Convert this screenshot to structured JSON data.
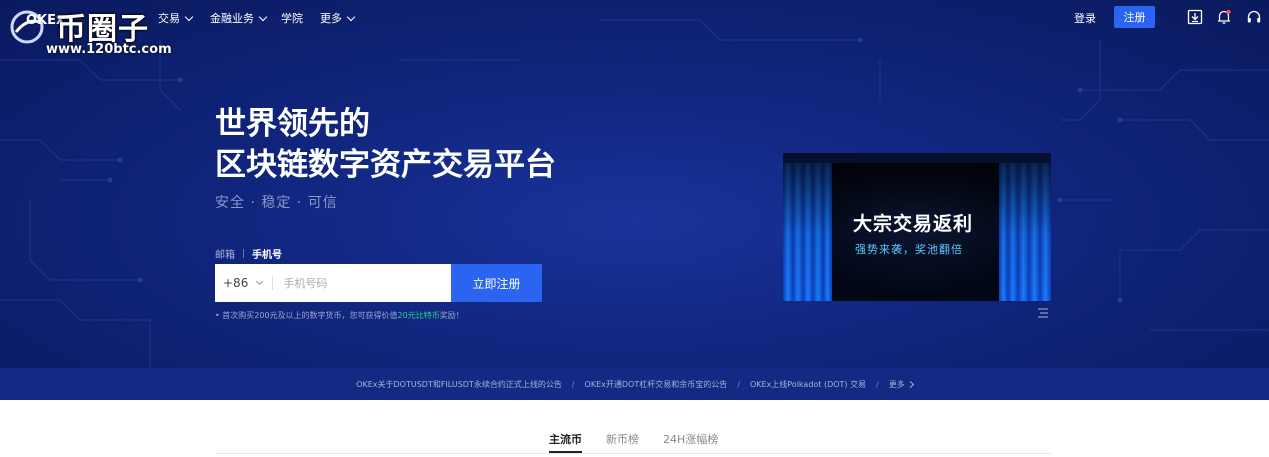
{
  "watermark": {
    "title": "币圈子",
    "url": "www.120btc.com"
  },
  "nav": {
    "brand": "OKEx",
    "items": [
      {
        "label": "交易",
        "has_dropdown": true
      },
      {
        "label": "金融业务",
        "has_dropdown": true
      },
      {
        "label": "学院",
        "has_dropdown": false
      },
      {
        "label": "更多",
        "has_dropdown": true
      }
    ],
    "login": "登录",
    "register": "注册",
    "icons": [
      "download-icon",
      "bell-icon",
      "headset-icon"
    ]
  },
  "hero": {
    "headline_line1": "世界领先的",
    "headline_line2": "区块链数字资产交易平台",
    "tagline": "安全 · 稳定 · 可信",
    "tab_email": "邮箱",
    "tab_phone": "手机号",
    "country_code": "+86",
    "phone_placeholder": "手机号码",
    "signup_button": "立即注册",
    "tip_prefix": "首次购买200元及以上的数字货币，您可获得价值",
    "tip_highlight": "20元比特币",
    "tip_suffix": "奖励！"
  },
  "banner": {
    "title": "大宗交易返利",
    "subtitle": "强势来袭，奖池翻倍"
  },
  "announcements": {
    "items": [
      "OKEx关于DOTUSDT和FILUSDT永续合约正式上线的公告",
      "OKEx开通DOT杠杆交易和余币宝的公告",
      "OKEx上线Polkadot (DOT) 交易"
    ],
    "separator": "/",
    "more": "更多"
  },
  "market_tabs": [
    {
      "label": "主流币",
      "active": true
    },
    {
      "label": "新币榜",
      "active": false
    },
    {
      "label": "24H涨幅榜",
      "active": false
    }
  ],
  "colors": {
    "hero_bg": "#10257d",
    "primary_button": "#2a64f0",
    "announcement_bg": "#122a84",
    "highlight_green": "#2fd183",
    "banner_sub": "#5cc8ff"
  }
}
